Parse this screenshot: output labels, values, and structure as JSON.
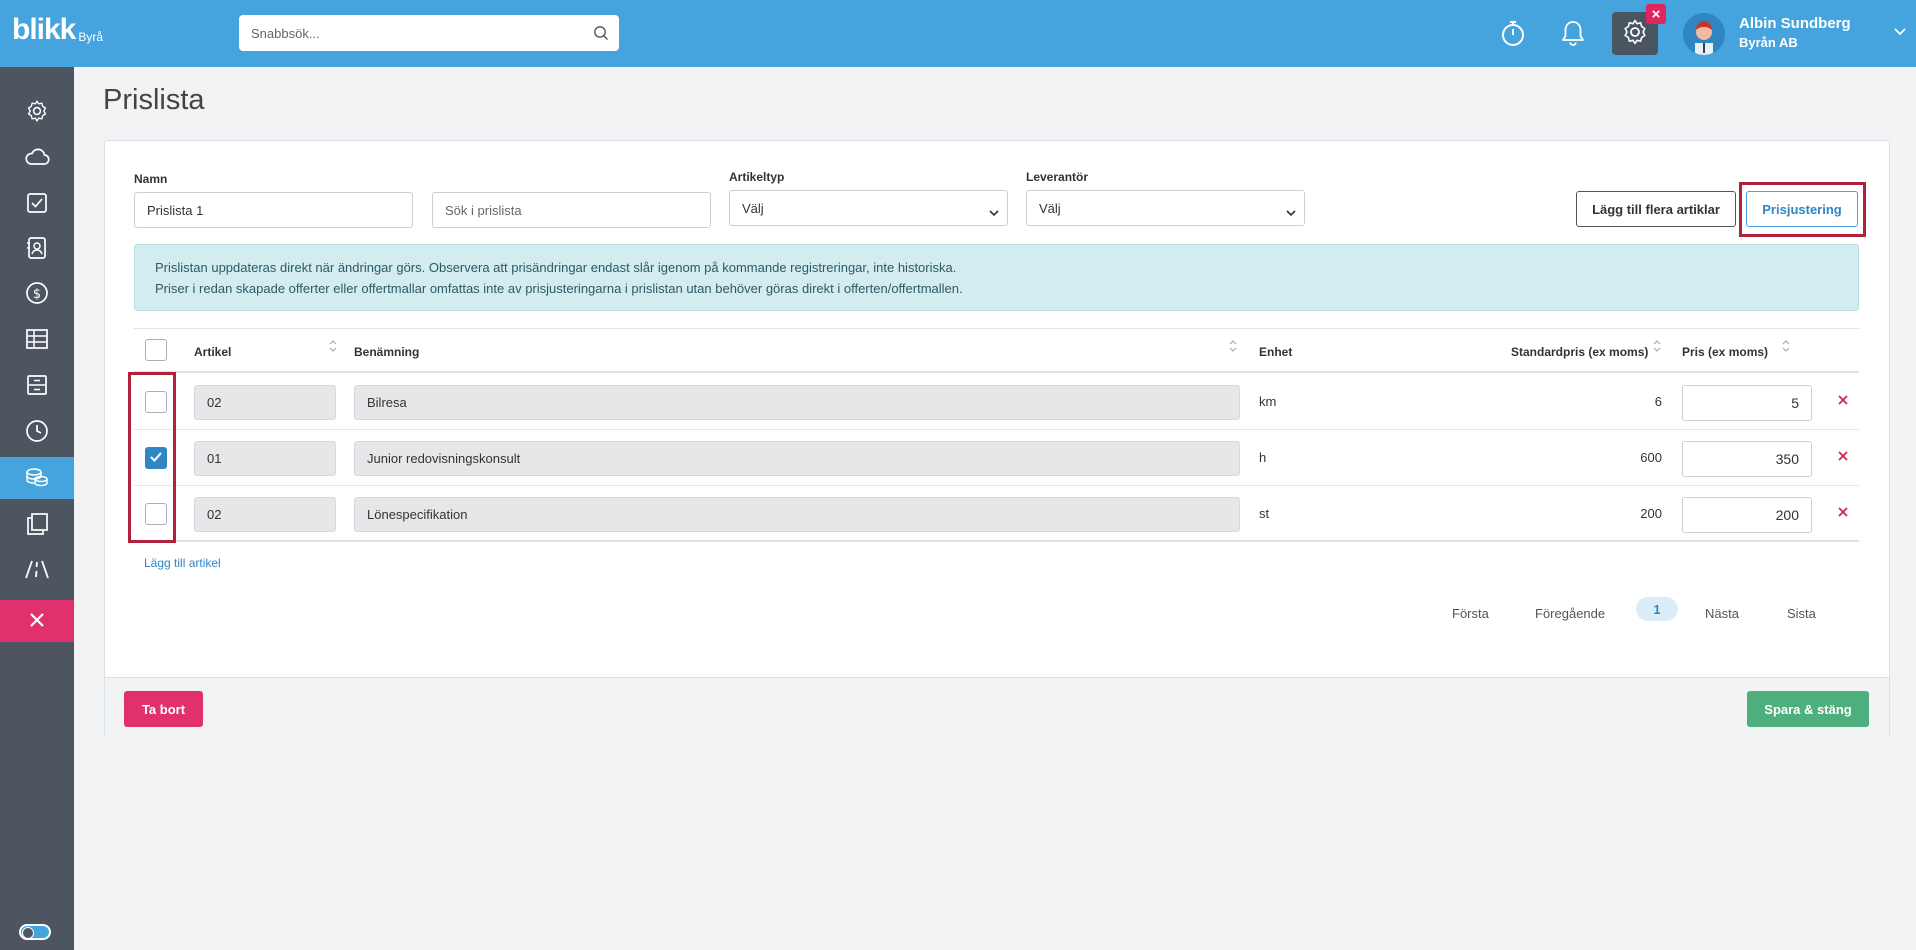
{
  "brand": {
    "name": "blikk",
    "sub": "Byrå"
  },
  "search": {
    "placeholder": "Snabbsök..."
  },
  "user": {
    "name": "Albin Sundberg",
    "company": "Byrån AB"
  },
  "icons": {
    "topbar": [
      "stopwatch-icon",
      "bell-icon",
      "gear-icon",
      "close-icon",
      "avatar",
      "chevron-down-icon"
    ],
    "sidebar": [
      "gear-icon",
      "cloud-icon",
      "checkbox-icon",
      "contact-card-icon",
      "dollar-icon",
      "table-icon",
      "archive-icon",
      "clock-icon",
      "coins-icon",
      "copy-icon",
      "road-icon",
      "close-icon",
      "toggle-icon"
    ]
  },
  "page": {
    "title": "Prislista"
  },
  "form": {
    "name_label": "Namn",
    "name_value": "Prislista 1",
    "search_placeholder": "Sök i prislista",
    "type_label": "Artikeltyp",
    "type_value": "Välj",
    "supplier_label": "Leverantör",
    "supplier_value": "Välj",
    "add_many_label": "Lägg till flera artiklar",
    "adjust_label": "Prisjustering"
  },
  "info": {
    "line1": "Prislistan uppdateras direkt när ändringar görs. Observera att prisändringar endast slår igenom på kommande registreringar, inte historiska.",
    "line2": "Priser i redan skapade offerter eller offertmallar omfattas inte av prisjusteringarna i prislistan utan behöver göras direkt i offerten/offertmallen."
  },
  "table": {
    "headers": {
      "article": "Artikel",
      "name": "Benämning",
      "unit": "Enhet",
      "std_price": "Standardpris (ex moms)",
      "price": "Pris (ex moms)"
    },
    "rows": [
      {
        "article": "02",
        "name": "Bilresa",
        "unit": "km",
        "std_price": "6",
        "price": "5",
        "checked": false
      },
      {
        "article": "01",
        "name": "Junior redovisningskonsult",
        "unit": "h",
        "std_price": "600",
        "price": "350",
        "checked": true
      },
      {
        "article": "02",
        "name": "Lönespecifikation",
        "unit": "st",
        "std_price": "200",
        "price": "200",
        "checked": false
      }
    ],
    "add_label": "Lägg till artikel"
  },
  "pagination": {
    "first": "Första",
    "prev": "Föregående",
    "current": "1",
    "next": "Nästa",
    "last": "Sista"
  },
  "footer": {
    "delete_label": "Ta bort",
    "save_label": "Spara & stäng"
  },
  "colors": {
    "primary": "#45a3dd",
    "sidebar": "#4d5560",
    "danger": "#e0306d",
    "success": "#4caf7d",
    "highlight": "#b2213c",
    "info_bg": "#d3ecef"
  }
}
